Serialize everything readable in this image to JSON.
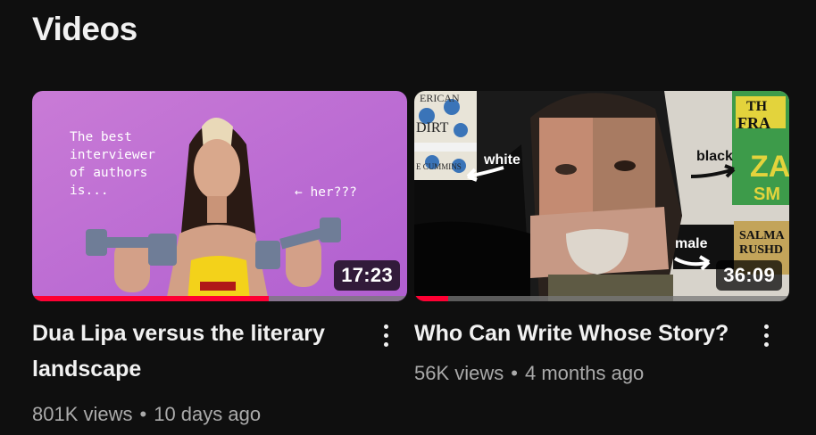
{
  "section": {
    "title": "Videos"
  },
  "videos": [
    {
      "title": "Dua Lipa versus the literary landscape",
      "views": "801K views",
      "age": "10 days ago",
      "duration": "17:23",
      "watched_fraction": 0.63,
      "thumbnail_text": {
        "intro": "The best\ninterviewer\nof authors\nis...",
        "pointer": "← her???"
      },
      "menu_icon": "more-vert-icon"
    },
    {
      "title": "Who Can Write Whose Story?",
      "views": "56K views",
      "age": "4 months ago",
      "duration": "36:09",
      "watched_fraction": 0.09,
      "thumbnail_text": {
        "label_white": "white",
        "label_black": "black",
        "label_male": "male",
        "book_left_top": "ERICAN",
        "book_left_mid": "DIRT",
        "book_left_bot": "E CUMMINS",
        "book_right_top": "TH",
        "book_right_mid": "FRA",
        "book_right_big": "ZA",
        "book_right_sm": "SM",
        "book_right_bot": "SALMA",
        "book_right_bot2": "RUSHD"
      },
      "menu_icon": "more-vert-icon"
    }
  ],
  "colors": {
    "progress": "#ff0033",
    "background": "#0f0f0f",
    "meta_text": "#aaaaaa"
  }
}
